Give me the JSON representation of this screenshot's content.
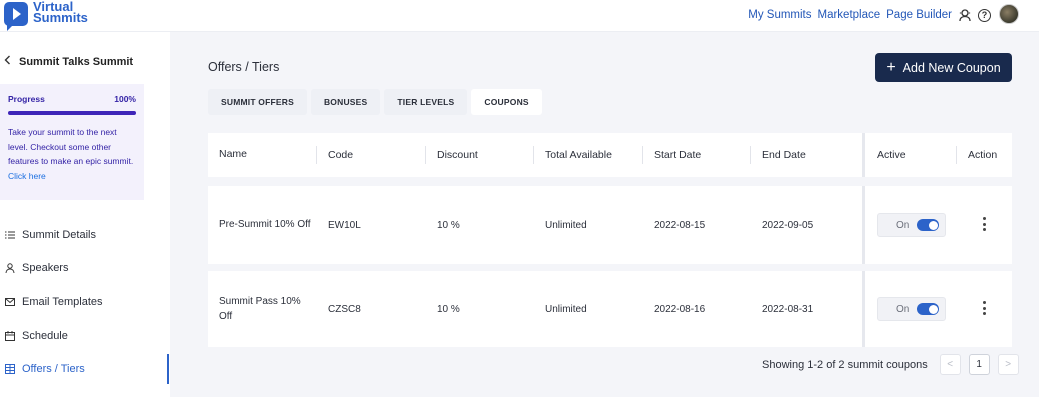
{
  "app": {
    "logo_line1": "Virtual",
    "logo_line2": "Summits"
  },
  "topnav": {
    "items": [
      "My Summits",
      "Marketplace",
      "Page Builder"
    ],
    "help_glyph": "?"
  },
  "sidebar": {
    "back_title": "Summit Talks Summit",
    "progress": {
      "label": "Progress",
      "value_text": "100%",
      "value": 1.0,
      "message": "Take your summit to the next level. Checkout some other features to make an epic summit.",
      "link": "Click here"
    },
    "items": [
      {
        "label": "Summit Details",
        "icon": "list-icon"
      },
      {
        "label": "Speakers",
        "icon": "user-icon"
      },
      {
        "label": "Email Templates",
        "icon": "mail-icon"
      },
      {
        "label": "Schedule",
        "icon": "calendar-icon"
      },
      {
        "label": "Offers / Tiers",
        "icon": "tiers-icon",
        "active": true
      }
    ]
  },
  "main": {
    "title": "Offers / Tiers",
    "add_button": "Add New Coupon",
    "add_icon": "+",
    "tabs": [
      {
        "label": "SUMMIT OFFERS"
      },
      {
        "label": "BONUSES"
      },
      {
        "label": "TIER LEVELS"
      },
      {
        "label": "COUPONS",
        "active": true
      }
    ],
    "table": {
      "headers": [
        "Name",
        "Code",
        "Discount",
        "Total Available",
        "Start Date",
        "End Date",
        "Active",
        "Action"
      ],
      "rows": [
        {
          "name": "Pre-Summit 10% Off",
          "code": "EW10L",
          "discount": "10 %",
          "total": "Unlimited",
          "start": "2022-08-15",
          "end": "2022-09-05",
          "active": "On"
        },
        {
          "name": "Summit Pass 10% Off",
          "code": "CZSC8",
          "discount": "10 %",
          "total": "Unlimited",
          "start": "2022-08-16",
          "end": "2022-08-31",
          "active": "On"
        }
      ]
    },
    "pagination": {
      "summary": "Showing 1-2 of 2 summit coupons",
      "page": "1",
      "prev": "<",
      "next": ">"
    }
  },
  "colors": {
    "brand": "#2c63c9",
    "button_dark": "#192a4d",
    "progress": "#3e25b8"
  }
}
